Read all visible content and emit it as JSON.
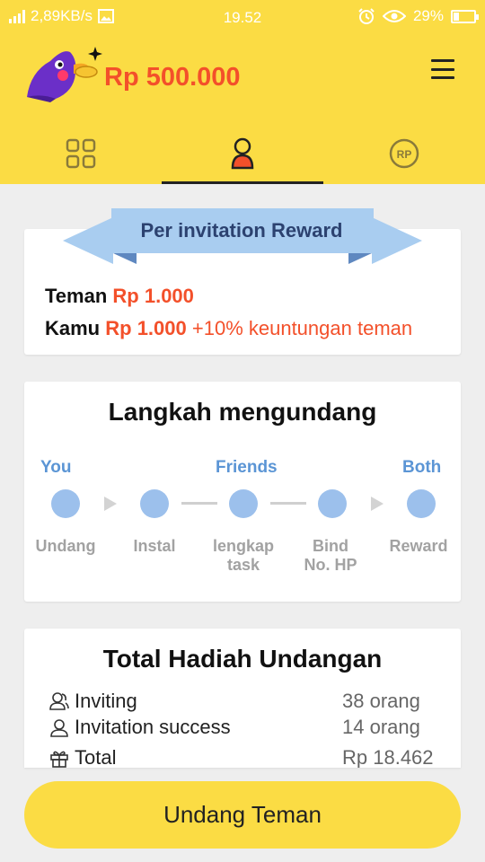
{
  "status_bar": {
    "network_speed": "2,89KB/s",
    "time": "19.52",
    "battery": "29%",
    "battery_level": 0.29,
    "icons": [
      "signal-icon",
      "image-icon",
      "alarm-icon",
      "eye-icon",
      "battery-icon"
    ]
  },
  "header": {
    "logo_icon": "bird-mascot-logo",
    "balance": "Rp 500.000",
    "menu_icon": "hamburger-menu-icon"
  },
  "tabs": [
    {
      "icon": "grid-icon",
      "active": false
    },
    {
      "icon": "user-icon",
      "active": true
    },
    {
      "icon": "rp-coin-icon",
      "active": false,
      "icon_text": "RP"
    }
  ],
  "reward_card": {
    "title": "Per invitation Reward",
    "friend_label": "Teman",
    "friend_amount": "Rp 1.000",
    "you_label": "Kamu",
    "you_amount": "Rp 1.000",
    "you_extra": "+10% keuntungan teman"
  },
  "steps_card": {
    "title": "Langkah mengundang",
    "roles": {
      "you": "You",
      "friends": "Friends",
      "both": "Both"
    },
    "steps": [
      "Undang",
      "Instal",
      "lengkap\ntask",
      "Bind\nNo. HP",
      "Reward"
    ]
  },
  "total_card": {
    "title": "Total Hadiah Undangan",
    "rows": [
      {
        "icon": "users-icon",
        "label": "Inviting",
        "value": "38 orang"
      },
      {
        "icon": "user-check-icon",
        "label": "Invitation success",
        "value": "14 orang"
      },
      {
        "icon": "gift-icon",
        "label": "Total",
        "value": "Rp 18.462"
      }
    ]
  },
  "invite_button": "Undang Teman",
  "colors": {
    "brand_yellow": "#fbdc44",
    "accent_red": "#f3502a",
    "step_blue": "#9cc0ec",
    "role_blue": "#5b95d5",
    "ribbon_blue": "#a9cdf0"
  }
}
